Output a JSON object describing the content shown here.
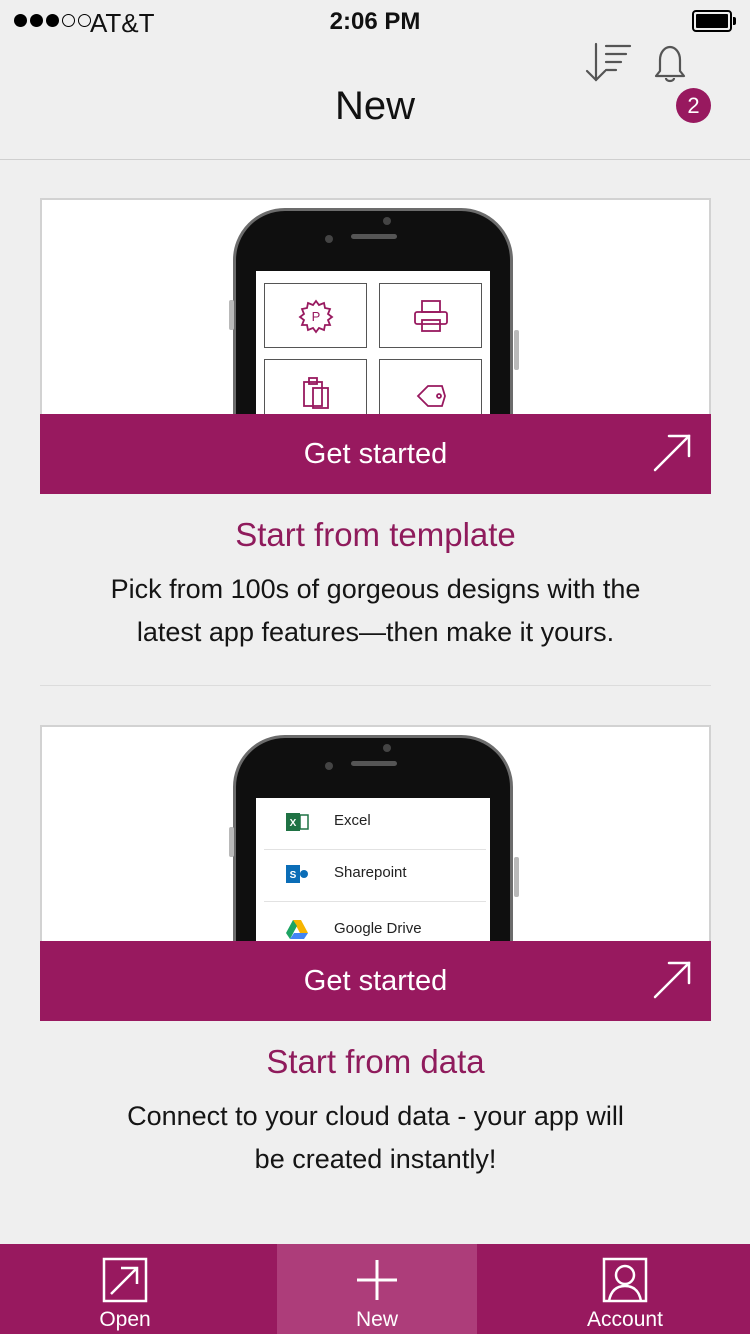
{
  "status_bar": {
    "carrier": "AT&T",
    "time": "2:06 PM",
    "signal_bars": 3,
    "signal_total": 5
  },
  "header": {
    "title": "New",
    "notification_count": "2",
    "sort_icon": "sort-icon",
    "bell_icon": "bell-icon"
  },
  "cards": [
    {
      "cta_label": "Get started",
      "title": "Start from template",
      "description_line1": "Pick from 100s of gorgeous designs with the",
      "description_line2": "latest app features—then make it yours.",
      "preview_icons": [
        "gear-badge-icon",
        "printer-icon",
        "clipboard-icon",
        "tag-icon"
      ]
    },
    {
      "cta_label": "Get started",
      "title": "Start from data",
      "description_line1": "Connect to your cloud data - your app will",
      "description_line2": "be created instantly!",
      "preview_sources": [
        {
          "label": "Excel",
          "icon": "excel-icon"
        },
        {
          "label": "Sharepoint",
          "icon": "sharepoint-icon"
        },
        {
          "label": "Google Drive",
          "icon": "google-drive-icon"
        }
      ]
    }
  ],
  "tab_bar": [
    {
      "label": "Open",
      "icon": "open-icon",
      "active": false
    },
    {
      "label": "New",
      "icon": "plus-icon",
      "active": true
    },
    {
      "label": "Account",
      "icon": "account-icon",
      "active": false
    }
  ],
  "colors": {
    "accent": "#98195f",
    "accent_active": "#ad3d7a",
    "title_text": "#8f1b5c",
    "background": "#efefef"
  }
}
